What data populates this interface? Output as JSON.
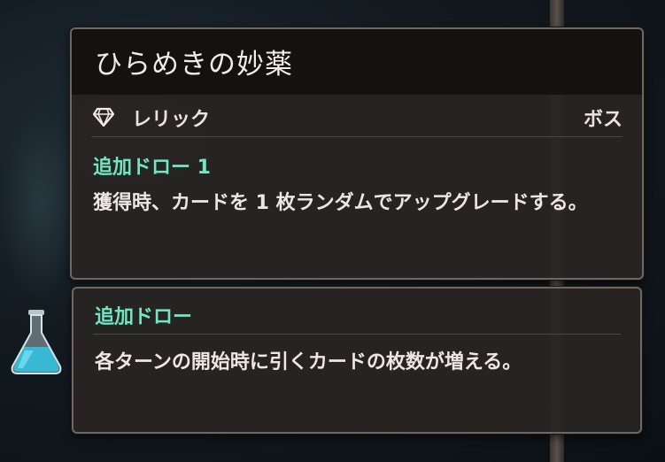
{
  "relic": {
    "title": "ひらめきの妙薬",
    "category": "レリック",
    "rarity": "ボス",
    "keyword": "追加ドロー 1",
    "description": "獲得時、カードを 1 枚ランダムでアップグレードする。",
    "icon": "gem-icon"
  },
  "effect": {
    "keyword": "追加ドロー",
    "description": "各ターンの開始時に引くカードの枚数が増える。",
    "icon": "potion-flask-icon"
  },
  "colors": {
    "keyword": "#6fe6c4",
    "text": "#ece7e1",
    "panel": "#282522",
    "border": "#6f6862"
  }
}
